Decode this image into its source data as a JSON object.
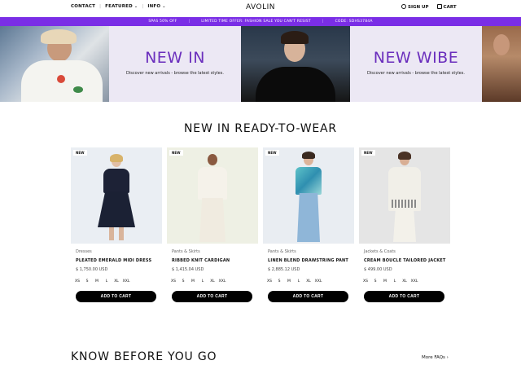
{
  "nav": {
    "contact": "CONTACT",
    "featured": "FEATURED",
    "info": "INFO",
    "brand": "AVOLIN",
    "sign_up": "SIGN UP",
    "cart": "CART"
  },
  "promo": {
    "item1": "SPAS 50% OFF",
    "item2": "LIMITED TIME OFFER: FASHION SALE YOU CAN'T RESIST",
    "item3": "CODE: SDHS3784A",
    "color": "#7a2ee6"
  },
  "hero": {
    "panel1_title": "NEW IN",
    "panel1_sub": "Discover new arrivals - browse the latest styles.",
    "panel2_title": "NEW WIBE",
    "panel2_sub": "Discover new arrivals - browse the latest styles.",
    "accent": "#6b2fbd"
  },
  "section_title": "NEW IN READY-TO-WEAR",
  "products": [
    {
      "badge": "NEW",
      "category": "Dresses",
      "name": "PLEATED EMERALD MIDI DRESS",
      "price": "$ 1,750.00 USD",
      "sizes": [
        "XS",
        "S",
        "M",
        "L",
        "XL",
        "XXL"
      ],
      "cta": "ADD TO CART"
    },
    {
      "badge": "NEW",
      "category": "Pants & Skirts",
      "name": "RIBBED KNIT CARDIGAN",
      "price": "$ 1,415.04 USD",
      "sizes": [
        "XS",
        "S",
        "M",
        "L",
        "XL",
        "XXL"
      ],
      "cta": "ADD TO CART"
    },
    {
      "badge": "NEW",
      "category": "Pants & Skirts",
      "name": "LINEN BLEND DRAWSTRING PANT",
      "price": "$ 2,885.12 USD",
      "sizes": [
        "XS",
        "S",
        "M",
        "L",
        "XL",
        "XXL"
      ],
      "cta": "ADD TO CART"
    },
    {
      "badge": "NEW",
      "category": "Jackets & Coats",
      "name": "CREAM BOUCLE TAILORED JACKET",
      "price": "$ 499.00 USD",
      "sizes": [
        "XS",
        "S",
        "M",
        "L",
        "XL",
        "XXL"
      ],
      "cta": "ADD TO CART"
    }
  ],
  "bottom": {
    "title": "KNOW BEFORE YOU GO",
    "more_faqs": "More FAQs"
  }
}
